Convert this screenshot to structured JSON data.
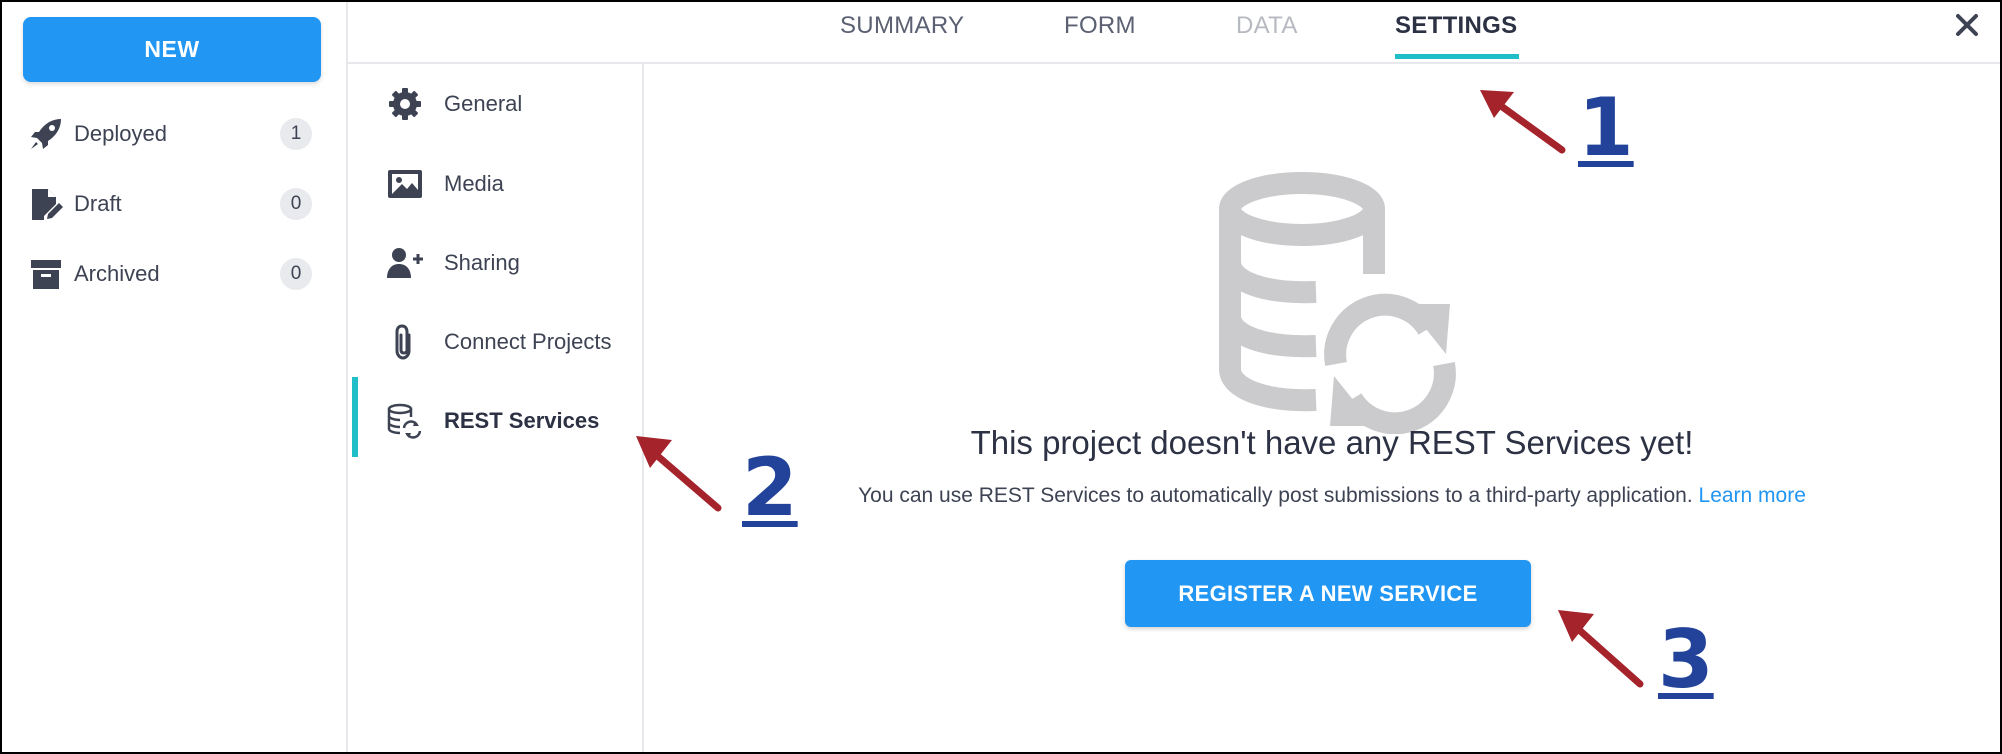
{
  "sidebar": {
    "new_label": "NEW",
    "statuses": [
      {
        "label": "Deployed",
        "count": "1",
        "icon": "rocket-icon"
      },
      {
        "label": "Draft",
        "count": "0",
        "icon": "draft-document-icon"
      },
      {
        "label": "Archived",
        "count": "0",
        "icon": "archive-box-icon"
      }
    ]
  },
  "tabs": [
    {
      "label": "SUMMARY",
      "state": "normal"
    },
    {
      "label": "FORM",
      "state": "normal"
    },
    {
      "label": "DATA",
      "state": "disabled"
    },
    {
      "label": "SETTINGS",
      "state": "active"
    }
  ],
  "settings_nav": [
    {
      "label": "General",
      "icon": "gear-icon"
    },
    {
      "label": "Media",
      "icon": "image-icon"
    },
    {
      "label": "Sharing",
      "icon": "add-user-icon"
    },
    {
      "label": "Connect Projects",
      "icon": "paperclip-icon"
    },
    {
      "label": "REST Services",
      "icon": "database-sync-icon",
      "active": true
    }
  ],
  "main": {
    "empty_title": "This project doesn't have any REST Services yet!",
    "empty_description": "You can use REST Services to automatically post submissions to a third-party application.",
    "learn_more": "Learn more",
    "register_label": "REGISTER A NEW SERVICE"
  },
  "annotations": [
    "1",
    "2",
    "3"
  ],
  "colors": {
    "primary_blue": "#2196f3",
    "active_teal": "#1fbec9",
    "annotation_arrow": "#a5232b",
    "annotation_number": "#23439a",
    "illustration_gray": "#cbcbcd"
  }
}
